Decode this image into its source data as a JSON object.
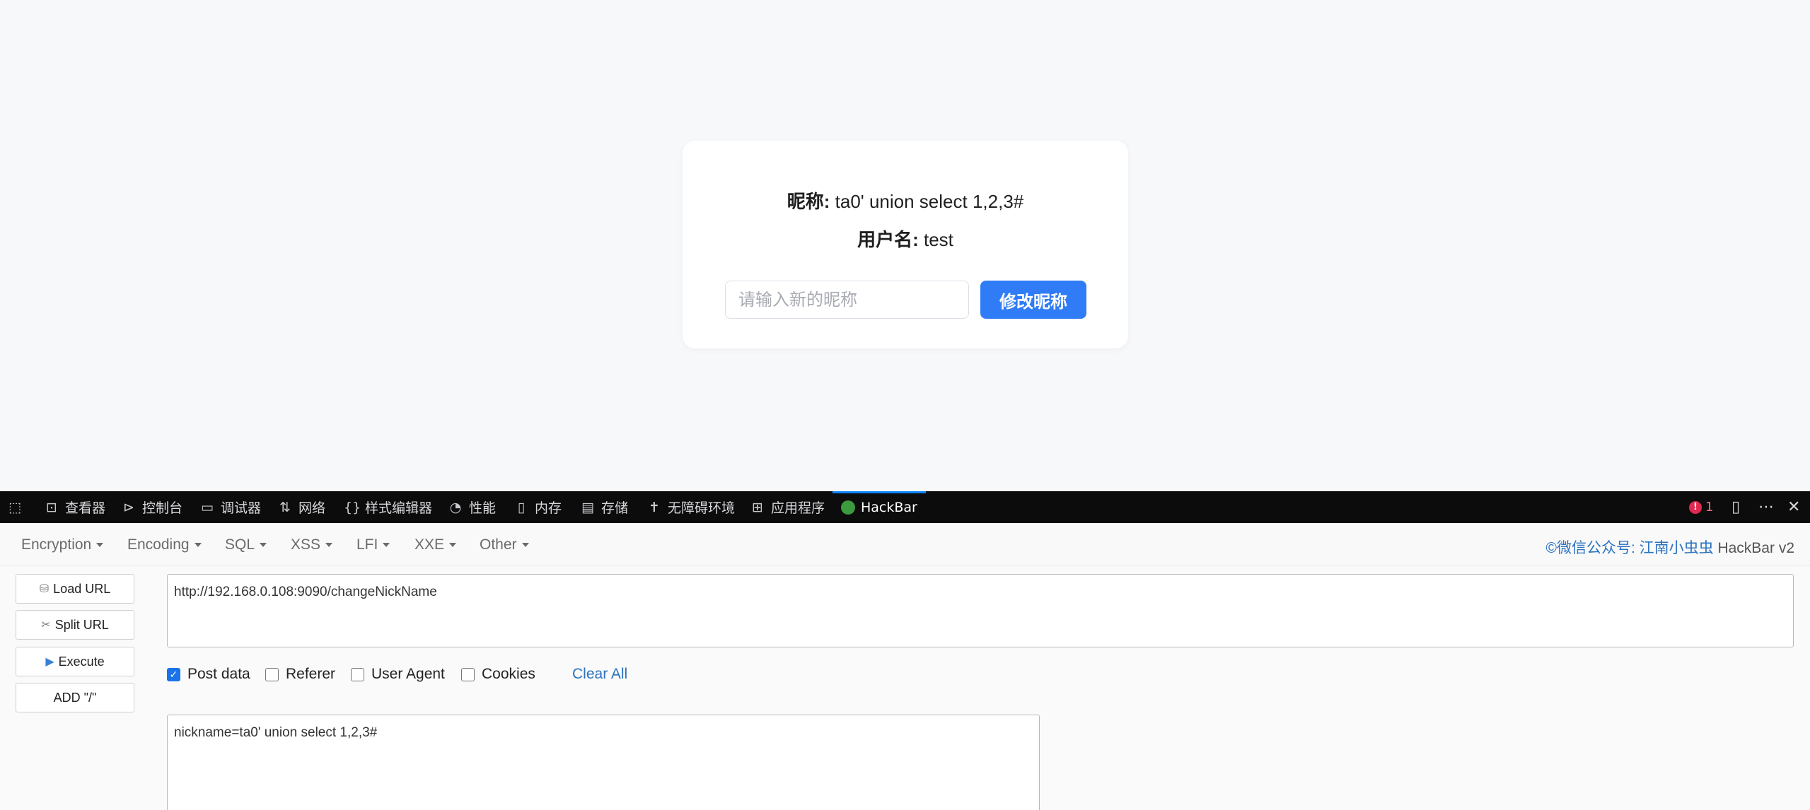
{
  "page": {
    "nickname_label": "昵称:",
    "nickname_value": "ta0' union select 1,2,3#",
    "username_label": "用户名:",
    "username_value": "test",
    "nickname_placeholder": "请输入新的昵称",
    "change_button": "修改昵称"
  },
  "devtools": {
    "tabs": [
      {
        "icon": "inspector-icon",
        "label": "查看器"
      },
      {
        "icon": "console-icon",
        "label": "控制台"
      },
      {
        "icon": "debugger-icon",
        "label": "调试器"
      },
      {
        "icon": "network-icon",
        "label": "网络"
      },
      {
        "icon": "style-editor-icon",
        "label": "样式编辑器"
      },
      {
        "icon": "performance-icon",
        "label": "性能"
      },
      {
        "icon": "memory-icon",
        "label": "内存"
      },
      {
        "icon": "storage-icon",
        "label": "存储"
      },
      {
        "icon": "accessibility-icon",
        "label": "无障碍环境"
      },
      {
        "icon": "application-icon",
        "label": "应用程序"
      },
      {
        "icon": "hackbar-icon",
        "label": "HackBar",
        "active": true
      }
    ],
    "error_count": "1",
    "accent_color": "#0a84ff"
  },
  "hackbar": {
    "menu": [
      "Encryption",
      "Encoding",
      "SQL",
      "XSS",
      "LFI",
      "XXE",
      "Other"
    ],
    "brand_link": "©微信公众号: 江南小虫虫",
    "brand_suffix": " HackBar v2",
    "buttons": {
      "load_url": "Load URL",
      "split_url": "Split URL",
      "execute": "Execute",
      "add_slash": "ADD \"/\""
    },
    "url_value": "http://192.168.0.108:9090/changeNickName",
    "options": {
      "post_data": {
        "label": "Post data",
        "checked": true
      },
      "referer": {
        "label": "Referer",
        "checked": false
      },
      "user_agent": {
        "label": "User Agent",
        "checked": false
      },
      "cookies": {
        "label": "Cookies",
        "checked": false
      }
    },
    "clear_all": "Clear All",
    "post_value": "nickname=ta0' union select 1,2,3#"
  }
}
